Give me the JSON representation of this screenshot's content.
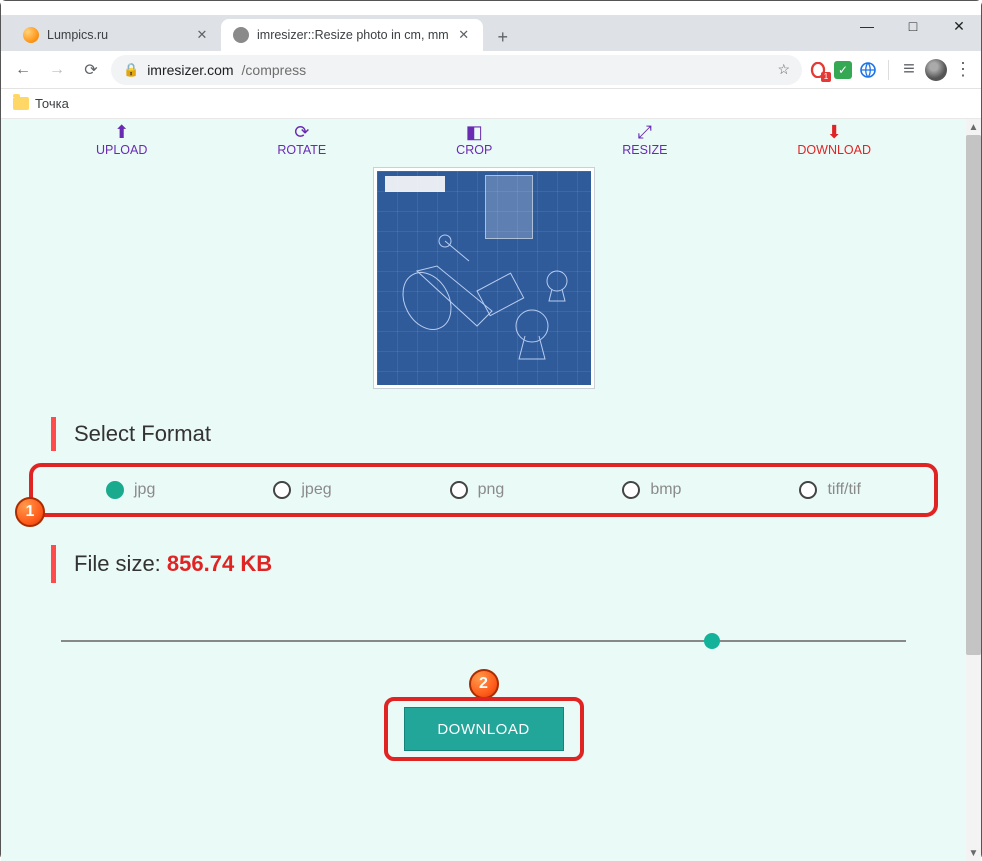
{
  "window": {
    "minimize": "—",
    "maximize": "□",
    "close": "✕"
  },
  "tabs": [
    {
      "title": "Lumpics.ru",
      "active": false
    },
    {
      "title": "imresizer::Resize photo in cm, mm",
      "active": true
    }
  ],
  "newtab": "+",
  "toolbar": {
    "url_host": "imresizer.com",
    "url_path": "/compress",
    "star": "☆",
    "ext_badge": "1",
    "reader": "≡",
    "menu": "⋮"
  },
  "bookmarks": {
    "item1": "Точка"
  },
  "steps": {
    "upload": "UPLOAD",
    "rotate": "ROTATE",
    "crop": "CROP",
    "resize": "RESIZE",
    "download": "DOWNLOAD"
  },
  "step_icons": {
    "upload": "⬆",
    "rotate": "⟳",
    "crop": "◧",
    "resize": "⤢",
    "download": "⬇"
  },
  "section": {
    "select_format": "Select Format"
  },
  "formats": {
    "jpg": "jpg",
    "jpeg": "jpeg",
    "png": "png",
    "bmp": "bmp",
    "tiff": "tiff/tif"
  },
  "filesize": {
    "label": "File size: ",
    "value": "856.74 KB"
  },
  "slider": {
    "percent": 77
  },
  "download": {
    "label": "DOWNLOAD"
  },
  "callouts": {
    "c1": "1",
    "c2": "2"
  }
}
